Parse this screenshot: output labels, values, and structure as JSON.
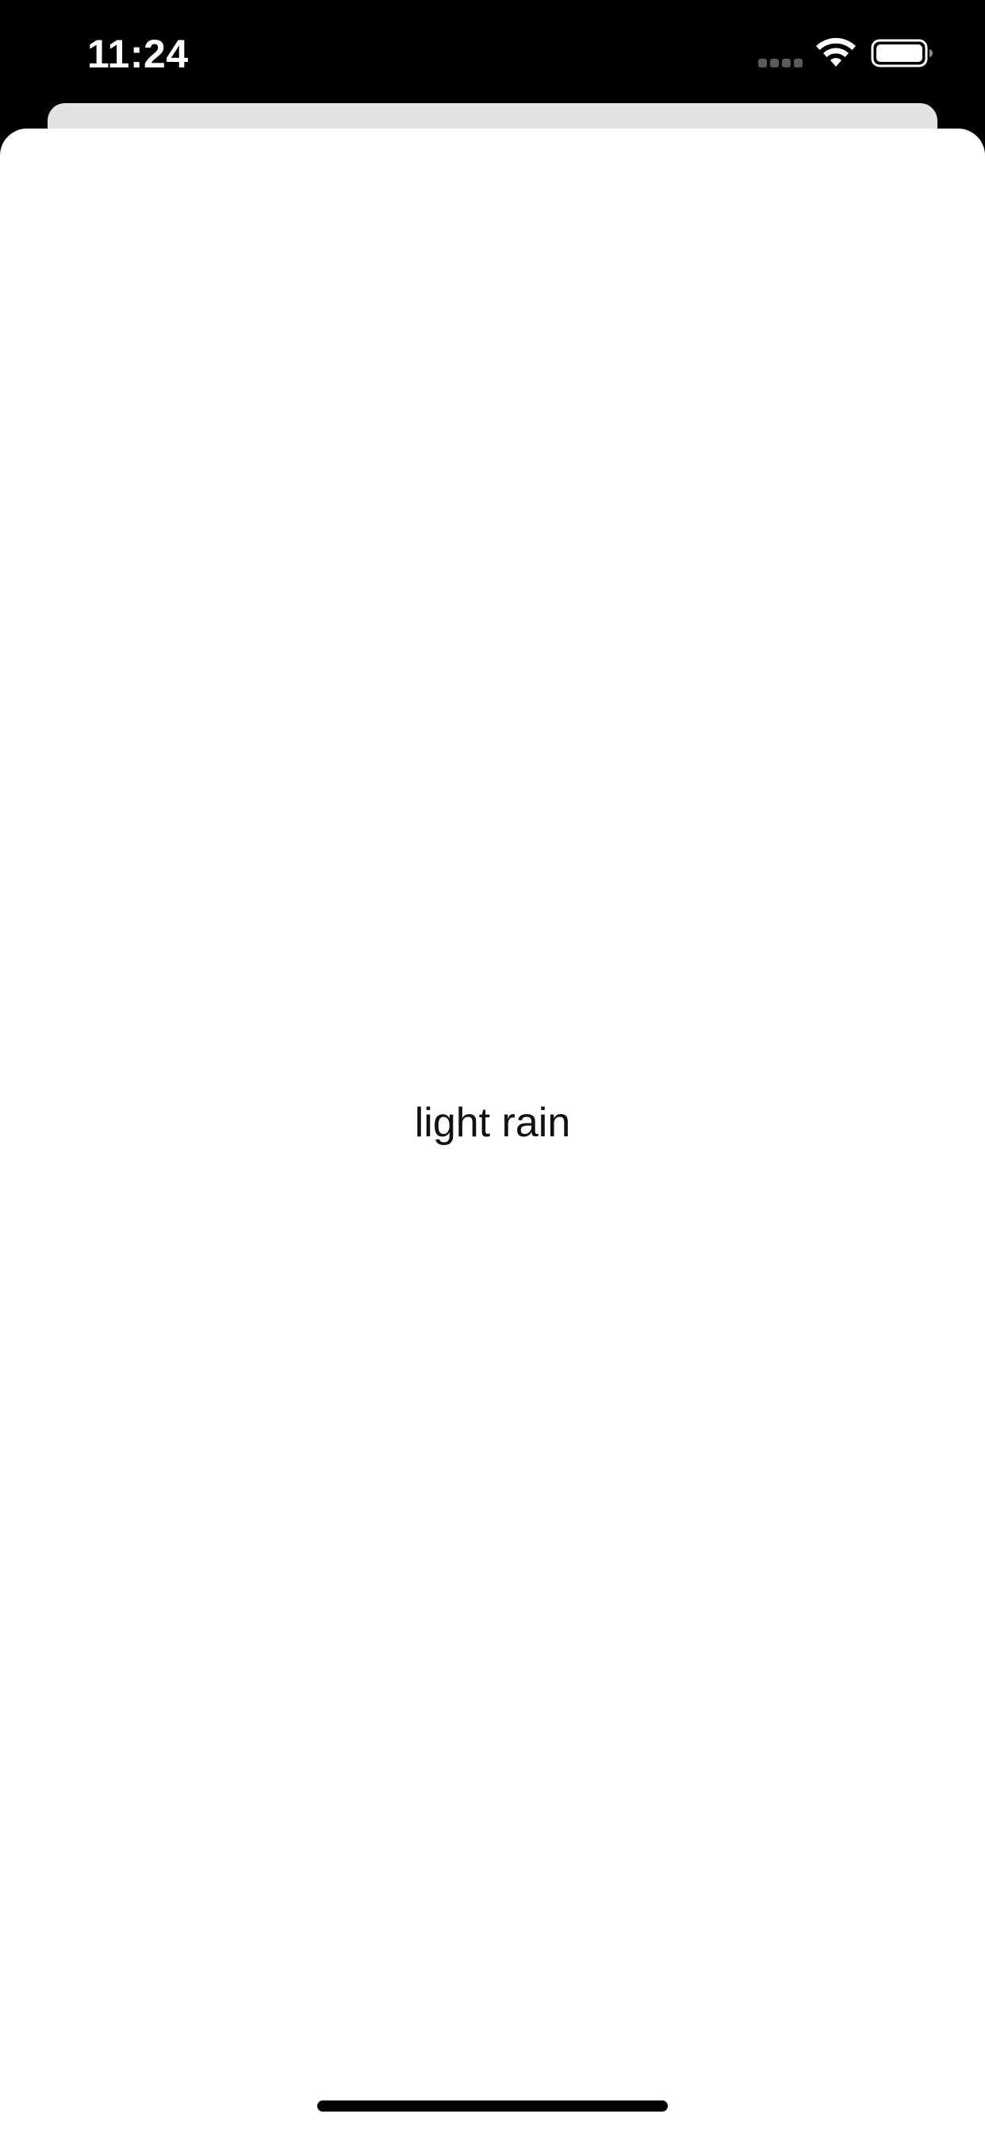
{
  "status_bar": {
    "time": "11:24",
    "signal_icon": "cellular-signal-icon",
    "wifi_icon": "wifi-icon",
    "battery_icon": "battery-icon"
  },
  "content": {
    "weather_description": "light rain"
  },
  "colors": {
    "status_bar_background": "#000000",
    "sheet_background": "#ffffff",
    "background_card": "#e2e2e2",
    "text": "#111111"
  }
}
